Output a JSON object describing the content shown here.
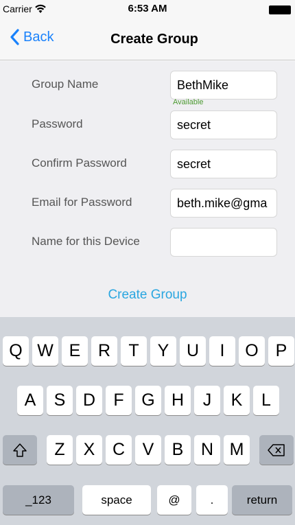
{
  "status_bar": {
    "carrier": "Carrier",
    "time": "6:53 AM"
  },
  "nav": {
    "back_label": "Back",
    "title": "Create Group"
  },
  "form": {
    "fields": [
      {
        "label": "Group Name",
        "value": "BethMike",
        "placeholder": ""
      },
      {
        "label": "Password",
        "value": "secret",
        "placeholder": ""
      },
      {
        "label": "Confirm Password",
        "value": "secret",
        "placeholder": ""
      },
      {
        "label": "Email for Password",
        "value": "beth.mike@gma",
        "placeholder": ""
      },
      {
        "label": "Name for this Device",
        "value": "",
        "placeholder": ""
      }
    ],
    "availability": "Available",
    "create_label": "Create Group"
  },
  "keyboard": {
    "row1": [
      "Q",
      "W",
      "E",
      "R",
      "T",
      "Y",
      "U",
      "I",
      "O",
      "P"
    ],
    "row2": [
      "A",
      "S",
      "D",
      "F",
      "G",
      "H",
      "J",
      "K",
      "L"
    ],
    "row3": [
      "Z",
      "X",
      "C",
      "V",
      "B",
      "N",
      "M"
    ],
    "numbers_label": "_123",
    "space_label": "space",
    "at_label": "@",
    "dot_label": ".",
    "return_label": "return"
  }
}
